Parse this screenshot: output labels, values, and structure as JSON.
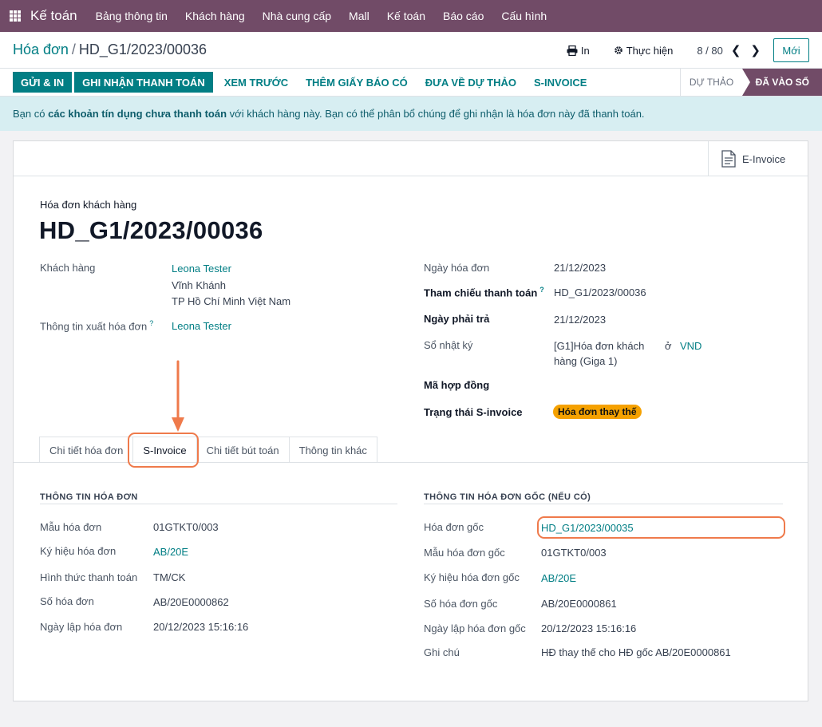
{
  "app": {
    "name": "Kế toán",
    "menu": [
      "Bảng thông tin",
      "Khách hàng",
      "Nhà cung cấp",
      "Mall",
      "Kế toán",
      "Báo cáo",
      "Cấu hình"
    ]
  },
  "breadcrumb": {
    "root": "Hóa đơn",
    "current": "HD_G1/2023/00036"
  },
  "control": {
    "print": "In",
    "action": "Thực hiện",
    "pager": "8 / 80",
    "new": "Mới"
  },
  "statusbar": {
    "buttons": [
      "GỬI & IN",
      "GHI NHẬN THANH TOÁN"
    ],
    "links": [
      "XEM TRƯỚC",
      "THÊM GIẤY BÁO CÓ",
      "ĐƯA VỀ DỰ THẢO",
      "S-INVOICE"
    ],
    "stages": [
      "DỰ THẢO",
      "ĐÃ VÀO SỔ"
    ]
  },
  "alert": {
    "prefix": "Bạn có ",
    "bold": "các khoản tín dụng chưa thanh toán",
    "suffix": " với khách hàng này. Bạn có thể phân bổ chúng để ghi nhận là hóa đơn này đã thanh toán."
  },
  "einvoice": "E-Invoice",
  "invoice": {
    "type": "Hóa đơn khách hàng",
    "number": "HD_G1/2023/00036",
    "customer_label": "Khách hàng",
    "customer_name": "Leona Tester",
    "customer_addr1": "Vĩnh Khánh",
    "customer_addr2": "TP Hồ Chí Minh Việt Nam",
    "billing_label": "Thông tin xuất hóa đơn",
    "billing_value": "Leona Tester",
    "date_label": "Ngày hóa đơn",
    "date_value": "21/12/2023",
    "ref_label": "Tham chiếu thanh toán",
    "ref_value": "HD_G1/2023/00036",
    "due_label": "Ngày phải trả",
    "due_value": "21/12/2023",
    "journal_label": "Sổ nhật ký",
    "journal_value1": "[G1]Hóa đơn khách",
    "journal_value2": "hàng (Giga 1)",
    "journal_in": "ở",
    "currency": "VND",
    "contract_label": "Mã hợp đồng",
    "sinv_state_label": "Trạng thái S-invoice",
    "sinv_state_value": "Hóa đơn thay thế",
    "help_mark": "?"
  },
  "tabs": [
    "Chi tiết hóa đơn",
    "S-Invoice",
    "Chi tiết bút toán",
    "Thông tin khác"
  ],
  "sinvoice": {
    "left_title": "THÔNG TIN HÓA ĐƠN",
    "left": [
      {
        "label": "Mẫu hóa đơn",
        "value": "01GTKT0/003",
        "link": false
      },
      {
        "label": "Ký hiệu hóa đơn",
        "value": "AB/20E",
        "link": true
      },
      {
        "label": "Hình thức thanh toán",
        "value": "TM/CK",
        "link": false
      },
      {
        "label": "Số hóa đơn",
        "value": "AB/20E0000862",
        "link": false
      },
      {
        "label": "Ngày lập hóa đơn",
        "value": "20/12/2023 15:16:16",
        "link": false
      }
    ],
    "right_title": "THÔNG TIN HÓA ĐƠN GỐC (NẾU CÓ)",
    "right": [
      {
        "label": "Hóa đơn gốc",
        "value": "HD_G1/2023/00035",
        "link": true
      },
      {
        "label": "Mẫu hóa đơn gốc",
        "value": "01GTKT0/003",
        "link": false
      },
      {
        "label": "Ký hiệu hóa đơn gốc",
        "value": "AB/20E",
        "link": true
      },
      {
        "label": "Số hóa đơn gốc",
        "value": "AB/20E0000861",
        "link": false
      },
      {
        "label": "Ngày lập hóa đơn gốc",
        "value": "20/12/2023 15:16:16",
        "link": false
      },
      {
        "label": "Ghi chú",
        "value": "HĐ thay thế cho HĐ gốc AB/20E0000861",
        "link": false
      }
    ]
  },
  "colors": {
    "brand": "#714b67",
    "accent": "#017e84",
    "highlight": "#ef7a4b",
    "badge": "#f5a100"
  }
}
